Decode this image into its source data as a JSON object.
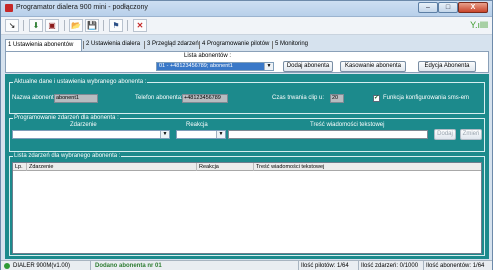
{
  "window": {
    "title": "Programator dialera 900 mini - podłączony"
  },
  "window_buttons": {
    "minimize": "–",
    "maximize": "□",
    "close": "X"
  },
  "toolbar": {
    "icons": [
      "pointer-icon",
      "down-arrow-icon",
      "sim-icon",
      "folder-open-icon",
      "save-icon",
      "flag-icon",
      "close-x-icon"
    ],
    "glyphs": [
      "↘",
      "⬇",
      "▣",
      "📂",
      "💾",
      "⚑",
      "✕"
    ],
    "signal": "Y.ıllll"
  },
  "tabs": [
    {
      "label": "1 Ustawienia abonentów",
      "active": true
    },
    {
      "label": "2 Ustawienia dialera",
      "active": false
    },
    {
      "label": "3 Przegląd zdarzeń",
      "active": false
    },
    {
      "label": "4 Programowanie pilotów",
      "active": false
    },
    {
      "label": "5 Monitoring",
      "active": false
    }
  ],
  "subscriber_list": {
    "label": "Lista abonentów :",
    "selected": "01 - +48123456789; abonent1",
    "add_button": "Dodaj abonenta",
    "delete_button": "Kasowanie abonenta",
    "edit_button": "Edycja Abonenta"
  },
  "current_settings": {
    "title": "Aktualne dane i ustawienia wybranego abonenta :",
    "name_label": "Nazwa abonenta:",
    "name_value": "abonent1",
    "phone_label": "Telefon abonenta:",
    "phone_value": "+48123456789",
    "clip_label": "Czas trwania clip u:",
    "clip_value": "20",
    "sms_label": "Funkcja konfigurowania sms-em",
    "sms_checked": true
  },
  "programming": {
    "title": "Programowanie zdarzeń dla abonenta :",
    "event_label": "Zdarzenie",
    "reaction_label": "Reakcja",
    "text_label": "Treść wiadomości tekstowej",
    "add_button": "Dodaj",
    "change_button": "Zmień"
  },
  "event_list": {
    "title": "Lista zdarzeń dla wybranego abonenta :",
    "columns": [
      "Lp.",
      "Zdarzenie",
      "Reakcja",
      "Treść wiadomości tekstowej"
    ],
    "rows": []
  },
  "status": {
    "device": "DIALER 900M(v1.00)",
    "message": "Dodano abonenta nr 01",
    "pilots": "Ilość pilotów: 1/64",
    "events": "Ilość zdarzeń: 0/1000",
    "subscribers": "Ilość abonentów: 1/64"
  },
  "colors": {
    "panel_teal": "#1c8a8c",
    "status_green": "#2e7d32",
    "selection_blue": "#3a78c8"
  }
}
